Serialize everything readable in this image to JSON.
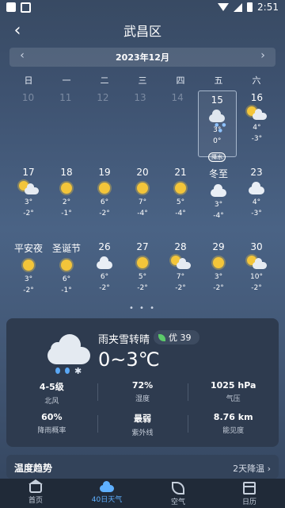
{
  "status": {
    "time": "2:51"
  },
  "header": {
    "title": "武昌区"
  },
  "month": {
    "label": "2023年12月",
    "prev_icon": "chevron-left-icon",
    "next_icon": "chevron-right-icon"
  },
  "weekdays": [
    "日",
    "一",
    "二",
    "三",
    "四",
    "五",
    "六"
  ],
  "calendar": [
    [
      {
        "d": "10",
        "muted": true
      },
      {
        "d": "11",
        "muted": true
      },
      {
        "d": "12",
        "muted": true
      },
      {
        "d": "13",
        "muted": true
      },
      {
        "d": "14",
        "muted": true
      },
      {
        "d": "15",
        "icon": "rain-snow",
        "hi": "3°",
        "lo": "0°",
        "badge": "降水",
        "selected": true
      },
      {
        "d": "16",
        "icon": "partly-cloudy",
        "hi": "4°",
        "lo": "-3°"
      }
    ],
    [
      {
        "d": "17",
        "icon": "partly-cloudy",
        "hi": "3°",
        "lo": "-2°"
      },
      {
        "d": "18",
        "icon": "sunny",
        "hi": "2°",
        "lo": "-1°"
      },
      {
        "d": "19",
        "icon": "sunny",
        "hi": "6°",
        "lo": "-2°"
      },
      {
        "d": "20",
        "icon": "sunny",
        "hi": "7°",
        "lo": "-4°"
      },
      {
        "d": "21",
        "icon": "sunny",
        "hi": "5°",
        "lo": "-4°"
      },
      {
        "d": "冬至",
        "icon": "cloudy",
        "hi": "3°",
        "lo": "-4°"
      },
      {
        "d": "23",
        "icon": "cloudy",
        "hi": "4°",
        "lo": "-3°"
      }
    ],
    [
      {
        "d": "平安夜",
        "icon": "sunny",
        "hi": "3°",
        "lo": "-2°"
      },
      {
        "d": "圣诞节",
        "icon": "sunny",
        "hi": "6°",
        "lo": "-1°"
      },
      {
        "d": "26",
        "icon": "cloudy",
        "hi": "6°",
        "lo": "-2°"
      },
      {
        "d": "27",
        "icon": "sunny",
        "hi": "5°",
        "lo": "-2°"
      },
      {
        "d": "28",
        "icon": "partly-cloudy",
        "hi": "7°",
        "lo": "-2°"
      },
      {
        "d": "29",
        "icon": "sunny",
        "hi": "3°",
        "lo": "-2°"
      },
      {
        "d": "30",
        "icon": "partly-cloudy",
        "hi": "10°",
        "lo": "-2°"
      }
    ]
  ],
  "pager": "• • •",
  "detail": {
    "icon": "rain-snow-icon",
    "condition": "雨夹雪转晴",
    "aqi": "优 39",
    "temp": "0~3℃",
    "stats": [
      {
        "value": "4-5级",
        "label": "北风"
      },
      {
        "value": "72%",
        "label": "湿度"
      },
      {
        "value": "1025 hPa",
        "label": "气压"
      },
      {
        "value": "60%",
        "label": "降雨概率"
      },
      {
        "value": "最弱",
        "label": "紫外线"
      },
      {
        "value": "8.76 km",
        "label": "能见度"
      }
    ]
  },
  "trend": {
    "label": "温度趋势",
    "link": "2天降温 ›"
  },
  "nav": [
    {
      "label": "首页",
      "icon": "home-icon",
      "active": false
    },
    {
      "label": "40日天气",
      "icon": "cloud-icon",
      "active": true
    },
    {
      "label": "空气",
      "icon": "leaf-icon",
      "active": false
    },
    {
      "label": "日历",
      "icon": "calendar-icon",
      "active": false
    }
  ]
}
